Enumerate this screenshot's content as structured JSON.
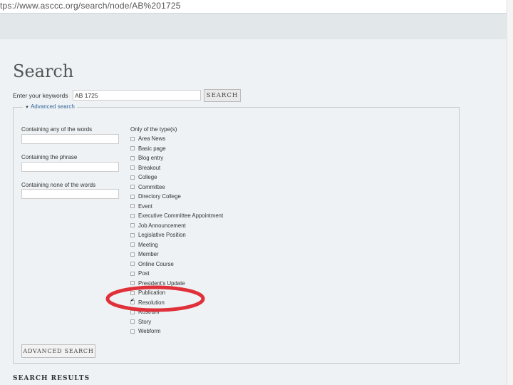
{
  "browser": {
    "url": "tps://www.asccc.org/search/node/AB%201725"
  },
  "page": {
    "title": "Search"
  },
  "search": {
    "keywords_label": "Enter your keywords",
    "keywords_value": "AB 1725",
    "submit_label": "SEARCH"
  },
  "advanced": {
    "legend": "Advanced search",
    "any_words_label": "Containing any of the words",
    "phrase_label": "Containing the phrase",
    "none_words_label": "Containing none of the words",
    "types_label": "Only of the type(s)",
    "types": [
      {
        "label": "Area News",
        "checked": false
      },
      {
        "label": "Basic page",
        "checked": false
      },
      {
        "label": "Blog entry",
        "checked": false
      },
      {
        "label": "Breakout",
        "checked": false
      },
      {
        "label": "College",
        "checked": false
      },
      {
        "label": "Committee",
        "checked": false
      },
      {
        "label": "Directory College",
        "checked": false
      },
      {
        "label": "Event",
        "checked": false
      },
      {
        "label": "Executive Committee Appointment",
        "checked": false
      },
      {
        "label": "Job Announcement",
        "checked": false
      },
      {
        "label": "Legislative Position",
        "checked": false
      },
      {
        "label": "Meeting",
        "checked": false
      },
      {
        "label": "Member",
        "checked": false
      },
      {
        "label": "Online Course",
        "checked": false
      },
      {
        "label": "Post",
        "checked": false
      },
      {
        "label": "President's Update",
        "checked": false
      },
      {
        "label": "Publication",
        "checked": false
      },
      {
        "label": "Resolution",
        "checked": true
      },
      {
        "label": "Rostrum",
        "checked": false
      },
      {
        "label": "Story",
        "checked": false
      },
      {
        "label": "Webform",
        "checked": false
      }
    ],
    "submit_label": "ADVANCED SEARCH"
  },
  "results": {
    "heading": "SEARCH RESULTS"
  },
  "colors": {
    "annotation": "#e0303a",
    "legend_link": "#336699"
  }
}
